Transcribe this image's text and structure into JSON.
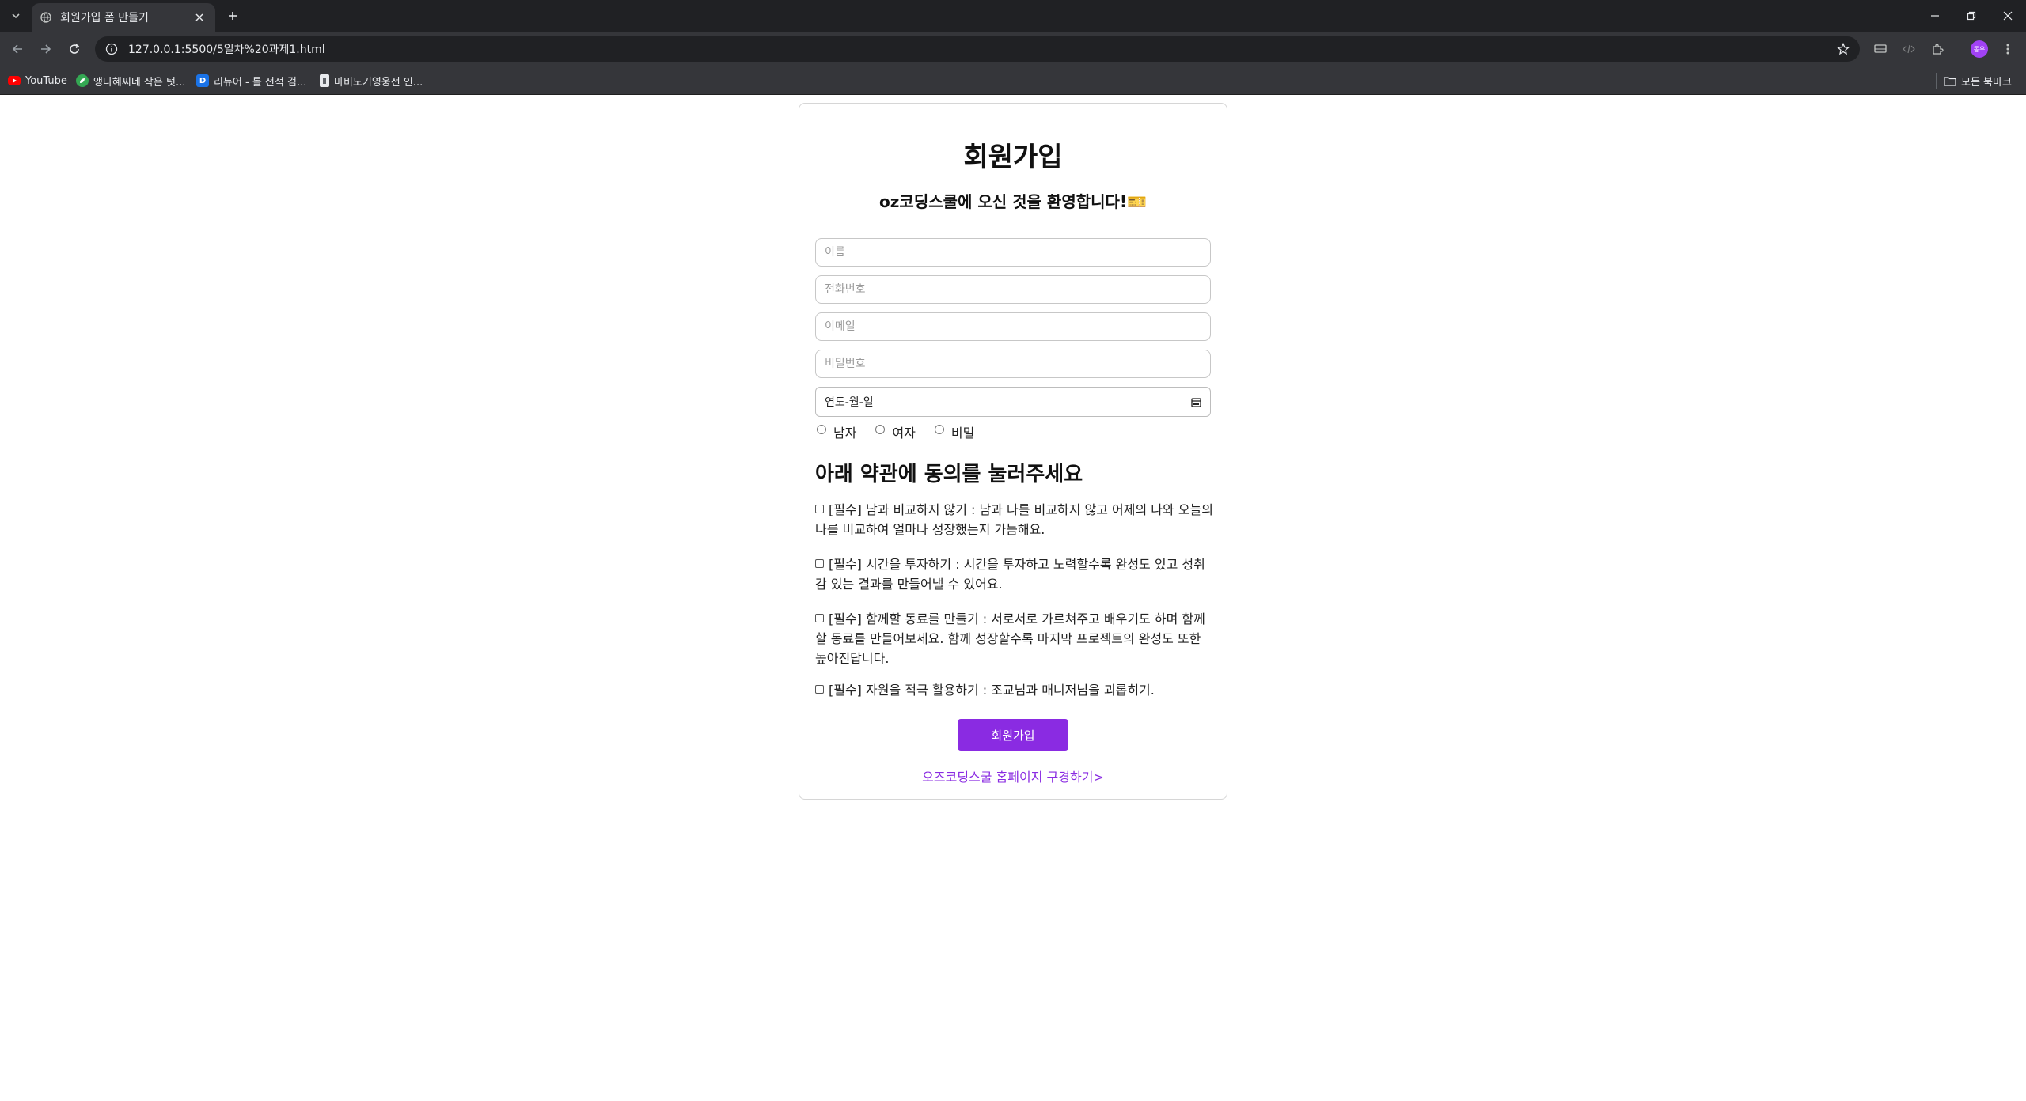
{
  "browser": {
    "tab_title": "회원가입 폼 만들기",
    "url": "127.0.0.1:5500/5일차%20과제1.html",
    "profile_label": "동우",
    "bookmarks": [
      {
        "label": "YouTube",
        "icon": "youtube-icon",
        "color": "#ff0000"
      },
      {
        "label": "앵다혜씨네 작은 텃...",
        "icon": "leaf-icon",
        "color": "#34a853"
      },
      {
        "label": "리뉴어 - 롤 전적 검...",
        "icon": "d-letter-icon",
        "color": "#1a73e8"
      },
      {
        "label": "마비노기영웅전 인...",
        "icon": "bookmark-page-icon",
        "color": "#bdbdbd"
      }
    ],
    "all_bookmarks_label": "모든 북마크"
  },
  "form": {
    "title": "회원가입",
    "subtitle": "oz코딩스쿨에 오신 것을 환영합니다!🎫",
    "fields": {
      "name_placeholder": "이름",
      "phone_placeholder": "전화번호",
      "email_placeholder": "이메일",
      "password_placeholder": "비밀번호",
      "date_placeholder": "연도-월-일"
    },
    "gender_options": [
      "남자",
      "여자",
      "비밀"
    ],
    "terms_heading": "아래 약관에 동의를 눌러주세요",
    "terms": [
      "[필수] 남과 비교하지 않기 : 남과 나를 비교하지 않고 어제의 나와 오늘의 나를 비교하여 얼마나 성장했는지 가늠해요.",
      "[필수] 시간을 투자하기 : 시간을 투자하고 노력할수록 완성도 있고 성취감 있는 결과를 만들어낼 수 있어요.",
      "[필수] 함께할 동료를 만들기 : 서로서로 가르쳐주고 배우기도 하며 함께할 동료를 만들어보세요. 함께 성장할수록 마지막 프로젝트의 완성도 또한 높아진답니다.",
      "[필수] 자원을 적극 활용하기 : 조교님과 매니저님을 괴롭히기."
    ],
    "submit_label": "회원가입",
    "home_link": "오즈코딩스쿨 홈페이지 구경하기>",
    "accent_color": "#8a2be2"
  }
}
